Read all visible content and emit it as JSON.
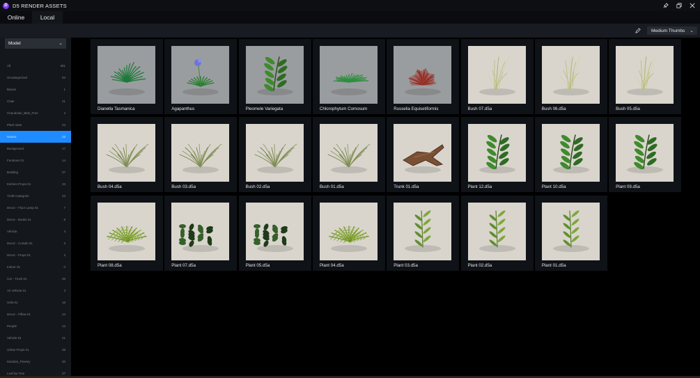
{
  "app": {
    "title": "D5 RENDER ASSETS",
    "logo_glyph": "D",
    "accent": "#7e3cf0"
  },
  "window_controls": [
    {
      "name": "pin-icon",
      "glyph": "⚲"
    },
    {
      "name": "restore-icon",
      "glyph": "❐"
    },
    {
      "name": "close-icon",
      "glyph": "✕"
    }
  ],
  "tabs": [
    {
      "label": "Online",
      "selected": false
    },
    {
      "label": "Local",
      "selected": true
    }
  ],
  "toolbar": {
    "edit_icon": "pencil-icon",
    "thumb_size": "Medium Thumbs"
  },
  "sidebar": {
    "filter_value": "Model",
    "selected_color": "#1e8bff",
    "categories": [
      {
        "label": "All",
        "count": "461"
      },
      {
        "label": "Uncategorized",
        "count": "92"
      },
      {
        "label": "Basics",
        "count": "1"
      },
      {
        "label": "Chair",
        "count": "21"
      },
      {
        "label": "Chandelier_Bbls_Free",
        "count": "2"
      },
      {
        "label": "Plant Vase",
        "count": "23"
      },
      {
        "label": "Nature",
        "count": "23"
      },
      {
        "label": "Background",
        "count": "17"
      },
      {
        "label": "Furniture 01",
        "count": "14"
      },
      {
        "label": "Building",
        "count": "37"
      },
      {
        "label": "Kitchen Props 01",
        "count": "33"
      },
      {
        "label": "Trolls Categorie",
        "count": "23"
      },
      {
        "label": "Decor - Floor Lamp 01",
        "count": "7"
      },
      {
        "label": "Decor - Books 01",
        "count": "9"
      },
      {
        "label": "Vehicle",
        "count": "4"
      },
      {
        "label": "Decor - Curtain 01",
        "count": "3"
      },
      {
        "label": "Decor - Props 01",
        "count": "2"
      },
      {
        "label": "Indoor 01",
        "count": "0"
      },
      {
        "label": "Car - Truck 01",
        "count": "26"
      },
      {
        "label": "Air Vehicle 01",
        "count": "3"
      },
      {
        "label": "Sofa 01",
        "count": "15"
      },
      {
        "label": "Decor - Pillow 01",
        "count": "14"
      },
      {
        "label": "People",
        "count": "12"
      },
      {
        "label": "Vehicle 01",
        "count": "21"
      },
      {
        "label": "Urban Props 01",
        "count": "39"
      },
      {
        "label": "Modular_Fleetey",
        "count": "20"
      },
      {
        "label": "Leaf bp Tree",
        "count": "27"
      }
    ],
    "selected_index": 6
  },
  "assets": [
    {
      "label": "Dianella Tasmanica",
      "icon": "grass-plant-icon",
      "bg": "gray"
    },
    {
      "label": "Agapanthus",
      "icon": "flower-plant-icon",
      "bg": "gray"
    },
    {
      "label": "Pleomele Variegata",
      "icon": "leafy-plant-icon",
      "bg": "gray"
    },
    {
      "label": "Chlorophytum Comosum",
      "icon": "spider-plant-icon",
      "bg": "gray"
    },
    {
      "label": "Russelia Equisetiformis",
      "icon": "red-shrub-icon",
      "bg": "gray"
    },
    {
      "label": "Bush 07.d5a",
      "icon": "dry-bush-icon",
      "bg": "beige"
    },
    {
      "label": "Bush 06.d5a",
      "icon": "dry-bush-icon",
      "bg": "beige"
    },
    {
      "label": "Bush 05.d5a",
      "icon": "dry-bush-icon",
      "bg": "beige"
    },
    {
      "label": "Bush 04.d5a",
      "icon": "grass-bush-icon",
      "bg": "beige"
    },
    {
      "label": "Bush 03.d5a",
      "icon": "grass-bush-icon",
      "bg": "beige"
    },
    {
      "label": "Bush 02.d5a",
      "icon": "grass-bush-icon",
      "bg": "beige"
    },
    {
      "label": "Bush 01.d5a",
      "icon": "grass-bush-icon",
      "bg": "beige"
    },
    {
      "label": "Trunk 01.d5a",
      "icon": "trunk-icon",
      "bg": "beige"
    },
    {
      "label": "Plant 12.d5a",
      "icon": "leafy-plant-icon",
      "bg": "beige"
    },
    {
      "label": "Plant 10.d5a",
      "icon": "leafy-plant-icon",
      "bg": "beige"
    },
    {
      "label": "Plant 09.d5a",
      "icon": "leafy-plant-icon",
      "bg": "beige"
    },
    {
      "label": "Plant 08.d5a",
      "icon": "fern-icon",
      "bg": "beige"
    },
    {
      "label": "Plant 07.d5a",
      "icon": "ground-cover-icon",
      "bg": "beige"
    },
    {
      "label": "Plant 05.d5a",
      "icon": "ground-cover-icon",
      "bg": "beige"
    },
    {
      "label": "Plant 04.d5a",
      "icon": "fern-icon",
      "bg": "beige"
    },
    {
      "label": "Plant 03.d5a",
      "icon": "sapling-icon",
      "bg": "beige"
    },
    {
      "label": "Plant 02.d5a",
      "icon": "sapling-icon",
      "bg": "beige"
    },
    {
      "label": "Plant 01.d5a",
      "icon": "sapling-icon",
      "bg": "beige"
    }
  ]
}
